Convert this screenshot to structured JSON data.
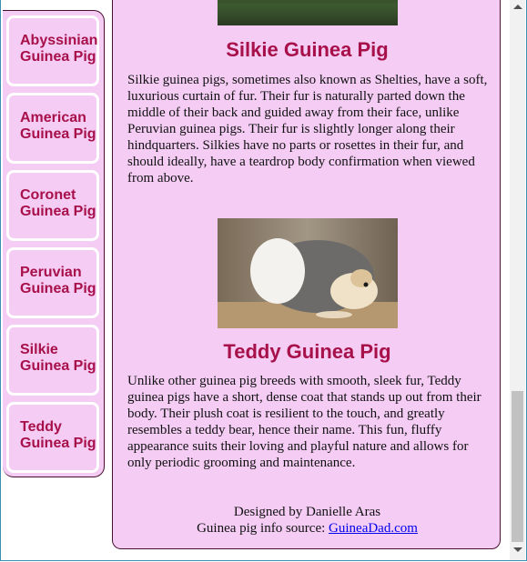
{
  "sidebar": {
    "items": [
      {
        "label": "Abyssinian Guinea Pig"
      },
      {
        "label": "American Guinea Pig"
      },
      {
        "label": "Coronet Guinea Pig"
      },
      {
        "label": "Peruvian Guinea Pig"
      },
      {
        "label": "Silkie Guinea Pig"
      },
      {
        "label": "Teddy Guinea Pig"
      }
    ]
  },
  "main": {
    "breeds": [
      {
        "title": "Silkie Guinea Pig",
        "description": "Silkie guinea pigs, sometimes also known as Shelties, have a soft, luxurious curtain of fur. Their fur is naturally parted down the middle of their back and guided away from their face, unlike Peruvian guinea pigs. Their fur is slightly longer along their hindquarters. Silkies have no parts or rosettes in their fur, and should ideally, have a teardrop body confirmation when viewed from above."
      },
      {
        "title": "Teddy Guinea Pig",
        "description": "Unlike other guinea pig breeds with smooth, sleek fur, Teddy guinea pigs have a short, dense coat that stands up out from their body. Their plush coat is resilient to the touch, and greatly resembles a teddy bear, hence their name. This fun, fluffy appearance suits their loving and playful nature and allows for only periodic grooming and maintenance."
      }
    ]
  },
  "footer": {
    "designer": "Designed by Danielle Aras",
    "source_prefix": "Guinea pig info source: ",
    "source_link": "GuineaDad.com"
  },
  "colors": {
    "panel_bg": "#f4ccf4",
    "heading": "#a8104a",
    "link": "#0000ee"
  }
}
